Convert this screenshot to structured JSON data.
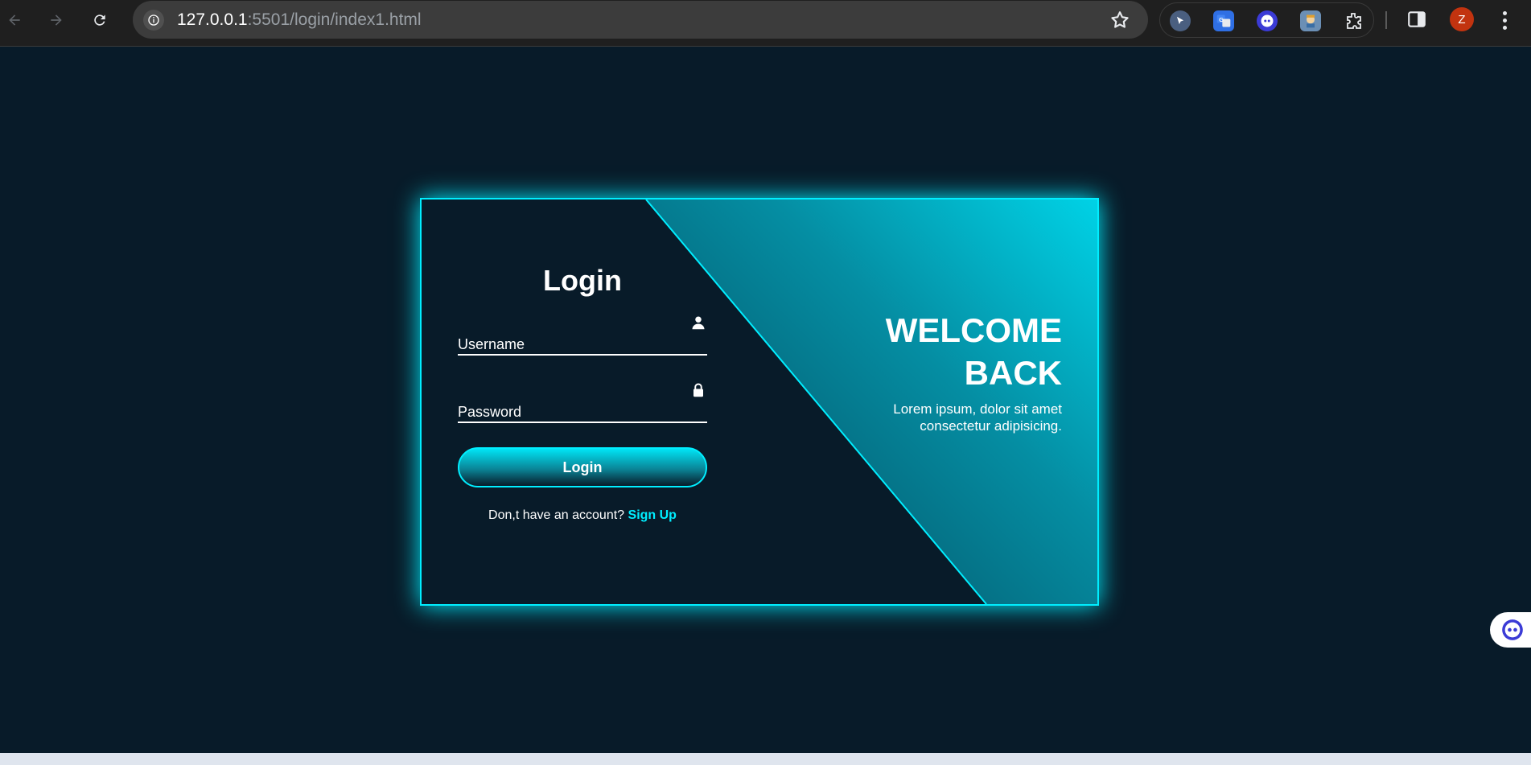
{
  "browser": {
    "url_host": "127.0.0.1",
    "url_rest": ":5501/login/index1.html",
    "avatar_letter": "Z"
  },
  "login": {
    "title": "Login",
    "username_label": "Username",
    "password_label": "Password",
    "button_label": "Login",
    "signup_prompt": "Don,t have an account?",
    "signup_link": "Sign Up"
  },
  "welcome": {
    "title_line1": "WELCOME",
    "title_line2": "BACK",
    "description": "Lorem ipsum, dolor sit amet consectetur adipisicing."
  },
  "theme": {
    "accent": "#00eeff",
    "background": "#081b29"
  }
}
